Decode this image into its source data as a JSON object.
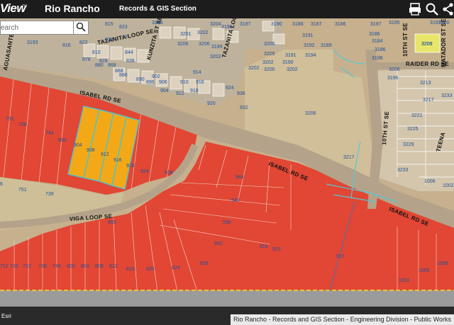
{
  "header": {
    "brand": "View",
    "brand_tm": "TM",
    "city": "Rio Rancho",
    "section": "Records & GIS Section"
  },
  "icons": [
    "print-icon",
    "search-icon",
    "share-icon"
  ],
  "search": {
    "placeholder": "earch"
  },
  "colors": {
    "header_bg": "#1c1c1c",
    "red_zone": "#e53524",
    "selected_parcel": "#f5b414",
    "parcel_label": "#1d4f9a",
    "parcel_outline": "#ffffff",
    "selected_outline": "#4fc2ce"
  },
  "roads": {
    "tazanita_loop_w": "TAZANITA LOOP SE",
    "kunzita": "KUNZITA ST SE",
    "tazanita_loop_e": "TAZANITA LOOP SE",
    "isabel_w": "ISABEL RD SE",
    "isabel_mid": "ISABEL RD SE",
    "isabel_e": "ISABEL RD SE",
    "viga_loop": "VIGA LOOP SE",
    "tenth_n": "10TH ST SE",
    "tenth_s": "10TH ST SE",
    "raider": "RAIDER RD SE",
    "matador": "MATADOR ST SE",
    "teena": "TEENA",
    "aguasantes": "AGUASANTES"
  },
  "parcels": {
    "top_row": [
      "3193",
      "816",
      "822",
      "824",
      "8",
      "815",
      "823",
      "3195",
      "3201",
      "3202",
      "3204",
      "3197",
      "3190",
      "3188",
      "3187",
      "3186",
      "3197",
      "3195",
      "3190",
      "3197",
      "3200"
    ],
    "block_rows": [
      "880",
      "888",
      "810",
      "868",
      "838",
      "844",
      "3206",
      "3206",
      "3199",
      "3191",
      "3186",
      "3184",
      "3186",
      "3206",
      "3205",
      "3202",
      "3191",
      "3194",
      "3192",
      "3189",
      "3198",
      "3202"
    ],
    "houses": [
      "878",
      "828",
      "886",
      "890",
      "896",
      "904",
      "912",
      "918",
      "906",
      "916",
      "920",
      "902",
      "910",
      "924",
      "936",
      "932",
      "914",
      "3202",
      "3200",
      "3190",
      "3202",
      "3209"
    ],
    "east": [
      "3206",
      "3213",
      "3217",
      "3221",
      "3225",
      "3229",
      "3233",
      "1006",
      "3217",
      "3233",
      "3196",
      "1002",
      "3206",
      "3209"
    ],
    "red_north": [
      "752",
      "728",
      "744",
      "800",
      "920",
      "924",
      "928",
      "944",
      "940",
      "936",
      "932",
      "919",
      "923",
      "917"
    ],
    "selected": [
      "904",
      "908",
      "912",
      "916"
    ],
    "west_lots": [
      "751",
      "739",
      "805",
      "6"
    ],
    "south_row": [
      "712",
      "720",
      "732",
      "736",
      "740",
      "800",
      "804",
      "808",
      "812",
      "816",
      "820",
      "824",
      "828"
    ],
    "south_east": [
      "1001",
      "1005",
      "1009"
    ]
  },
  "attribution": "Rio Rancho - Records and GIS Section - Engineering Division - Public Works",
  "esri_credit": "Esri"
}
